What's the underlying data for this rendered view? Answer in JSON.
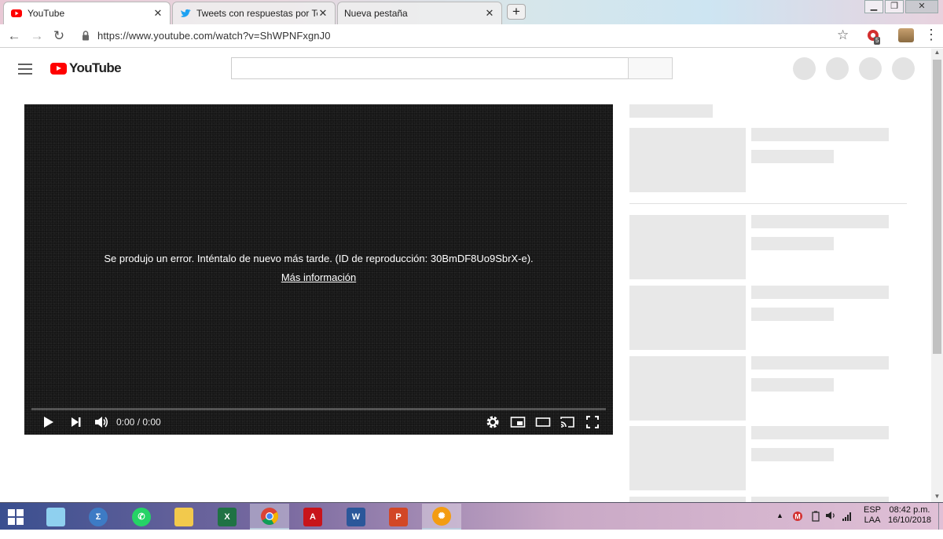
{
  "browser": {
    "tabs": [
      {
        "title": "YouTube",
        "active": true
      },
      {
        "title": "Tweets con respuestas por Team",
        "active": false
      },
      {
        "title": "Nueva pestaña",
        "active": false
      }
    ],
    "new_tab_label": "+",
    "url": "https://www.youtube.com/watch?v=ShWPNFxgnJ0",
    "extension_badge": "5"
  },
  "youtube": {
    "logo_text": "YouTube",
    "player": {
      "error_message": "Se produjo un error. Inténtalo de nuevo más tarde. (ID de reproducción: 30BmDF8Uo9SbrX-e).",
      "learn_more": "Más información",
      "time": "0:00 / 0:00"
    }
  },
  "taskbar": {
    "apps": [
      "Maps",
      "Calculator",
      "WhatsApp",
      "File Explorer",
      "Excel",
      "Chrome",
      "Acrobat",
      "Word",
      "PowerPoint",
      "Settings"
    ],
    "active_app": "Chrome",
    "language_top": "ESP",
    "language_bottom": "LAA",
    "time": "08:42 p.m.",
    "date": "16/10/2018"
  },
  "colors": {
    "youtube_red": "#ff0000",
    "player_bg": "#161616",
    "skeleton": "#e8e8e8"
  }
}
